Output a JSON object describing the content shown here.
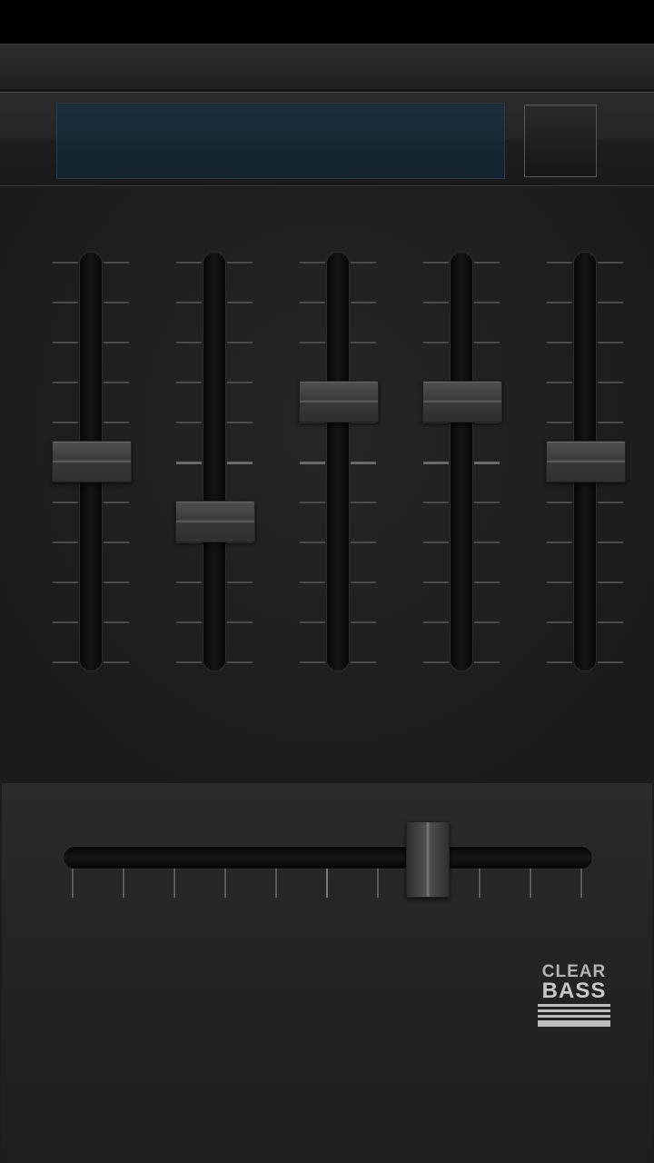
{
  "preset": {
    "display_text": "",
    "button_label": ""
  },
  "equalizer": {
    "bands": [
      {
        "level": 0.5
      },
      {
        "level": 0.35
      },
      {
        "level": 0.65
      },
      {
        "level": 0.65
      },
      {
        "level": 0.5
      }
    ]
  },
  "clear_bass": {
    "label_line1": "CLEAR",
    "label_line2": "BASS",
    "level": 0.7,
    "tick_count": 11
  },
  "colors": {
    "display_background": "#1c2e3a",
    "background": "#1c1c1c"
  }
}
